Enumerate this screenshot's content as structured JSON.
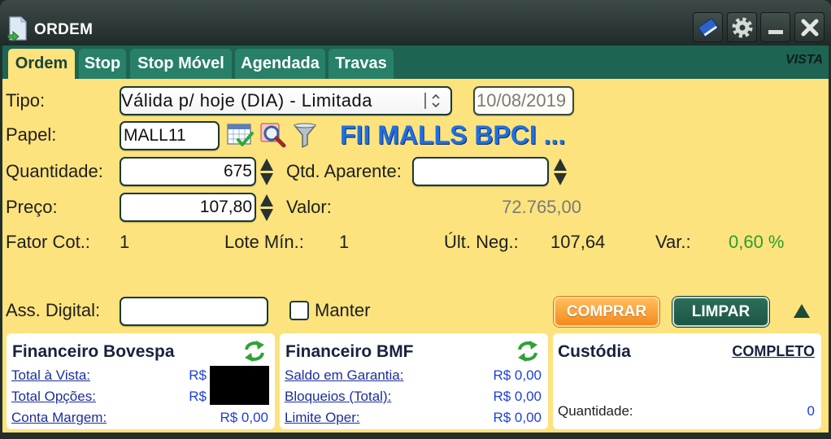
{
  "window": {
    "title": "ORDEM",
    "title_icon": "document-icon",
    "controls": [
      "book-icon",
      "gear-icon",
      "minimize-icon",
      "close-icon"
    ]
  },
  "tabs": [
    {
      "label": "Ordem",
      "active": true
    },
    {
      "label": "Stop",
      "active": false
    },
    {
      "label": "Stop Móvel",
      "active": false
    },
    {
      "label": "Agendada",
      "active": false
    },
    {
      "label": "Travas",
      "active": false
    }
  ],
  "market": "VISTA",
  "order": {
    "tipo": {
      "label": "Tipo:",
      "value": "Válida p/ hoje (DIA) - Limitada",
      "date": "10/08/2019"
    },
    "papel": {
      "label": "Papel:",
      "value": "MALL11",
      "asset_name": "FII MALLS BPCI ...",
      "icons": [
        "calendar-check-icon",
        "search-document-icon",
        "filter-icon"
      ]
    },
    "quantidade": {
      "label": "Quantidade:",
      "value": "675"
    },
    "qtd_aparente": {
      "label": "Qtd. Aparente:",
      "value": ""
    },
    "preco": {
      "label": "Preço:",
      "value": "107,80"
    },
    "valor": {
      "label": "Valor:",
      "value": "72.765,00"
    },
    "stats": {
      "fator_cot_label": "Fator Cot.:",
      "fator_cot": "1",
      "lote_min_label": "Lote Mín.:",
      "lote_min": "1",
      "ult_neg_label": "Últ. Neg.:",
      "ult_neg": "107,64",
      "var_label": "Var.:",
      "var": "0,60 %"
    },
    "ass_digital": {
      "label": "Ass. Digital:",
      "value": ""
    },
    "manter": {
      "label": "Manter",
      "checked": false
    }
  },
  "actions": {
    "buy": "COMPRAR",
    "clear": "LIMPAR",
    "collapse_icon": "triangle-up-icon"
  },
  "panels": {
    "bovespa": {
      "title": "Financeiro Bovespa",
      "rows": [
        {
          "label": "Total à Vista:",
          "value": "R$"
        },
        {
          "label": "Total Opções:",
          "value": "R$"
        },
        {
          "label": "Conta Margem:",
          "value": "R$ 0,00"
        }
      ]
    },
    "bmf": {
      "title": "Financeiro BMF",
      "rows": [
        {
          "label": "Saldo em Garantia:",
          "value": "R$ 0,00"
        },
        {
          "label": "Bloqueios (Total):",
          "value": "R$ 0,00"
        },
        {
          "label": "Limite Oper:",
          "value": "R$ 0,00"
        }
      ]
    },
    "custodia": {
      "title": "Custódia",
      "link": "COMPLETO",
      "quantidade_label": "Quantidade:",
      "quantidade": "0"
    }
  },
  "colors": {
    "body_bg": "#fce37e",
    "title_bar_top": "#3d4a47",
    "title_bar_bottom": "#1f2b28",
    "tab_strip": "#1d6453",
    "tab_bg": "#288069",
    "tab_active_text": "#1a4436",
    "asset_name": "#1f6fe3",
    "label_text": "#1e1e1e",
    "muted_value": "#7a7a7a",
    "positive": "#2a9f2a",
    "buy": "#f5891c",
    "clear": "#1d5646",
    "panel_title": "#17223d",
    "link_label": "#1c2f9a",
    "value_blue": "#1c3fe0",
    "refresh": "#2fa233"
  }
}
